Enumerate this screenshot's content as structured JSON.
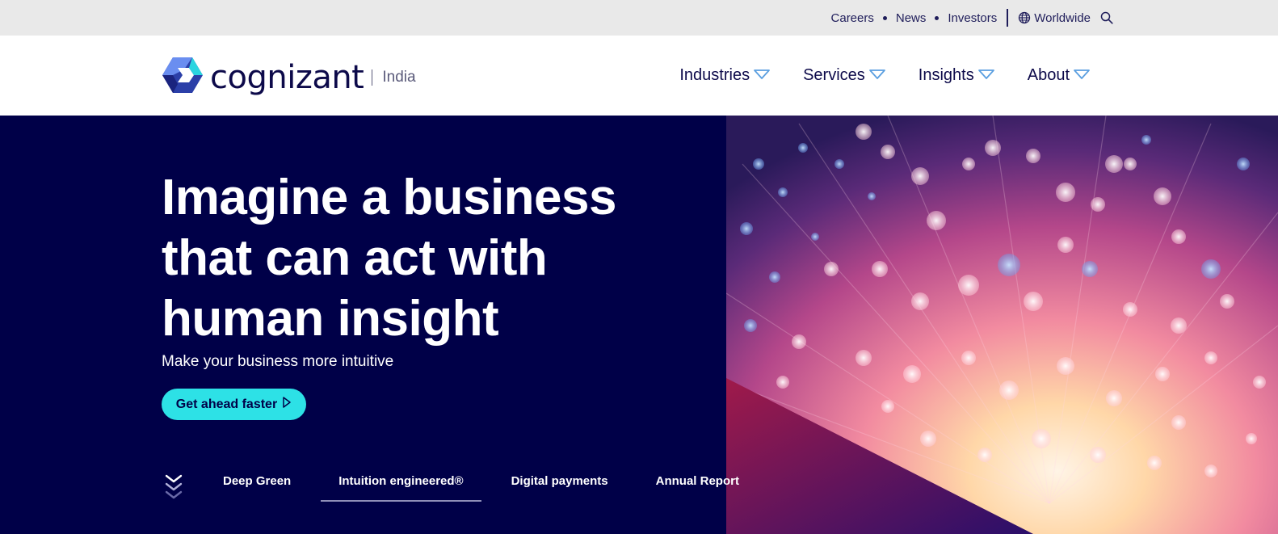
{
  "utility_nav": {
    "links": [
      "Careers",
      "News",
      "Investors"
    ],
    "region": "Worldwide"
  },
  "header": {
    "brand": "cognizant",
    "region": "India",
    "nav": [
      "Industries",
      "Services",
      "Insights",
      "About"
    ]
  },
  "hero": {
    "title_lines": [
      "Imagine a business",
      "that can act with",
      "human insight"
    ],
    "subtitle": "Make your business more intuitive",
    "cta": "Get ahead faster",
    "tabs": [
      "Deep Green",
      "Intuition engineered®",
      "Digital payments",
      "Annual Report"
    ],
    "active_tab": "Intuition engineered®"
  },
  "colors": {
    "hero_bg": "#000048",
    "cta_bg": "#2de1e6",
    "brand_text": "#0d0a4a",
    "utility_bg": "#e9e9e9",
    "nav_chevron": "#5b9fe0"
  },
  "icons": {
    "globe": "globe-icon",
    "search": "search-icon",
    "nav_chevron": "chevron-down-outline-icon",
    "cta_arrow": "play-outline-icon",
    "scroll": "triple-chevron-down-icon"
  }
}
